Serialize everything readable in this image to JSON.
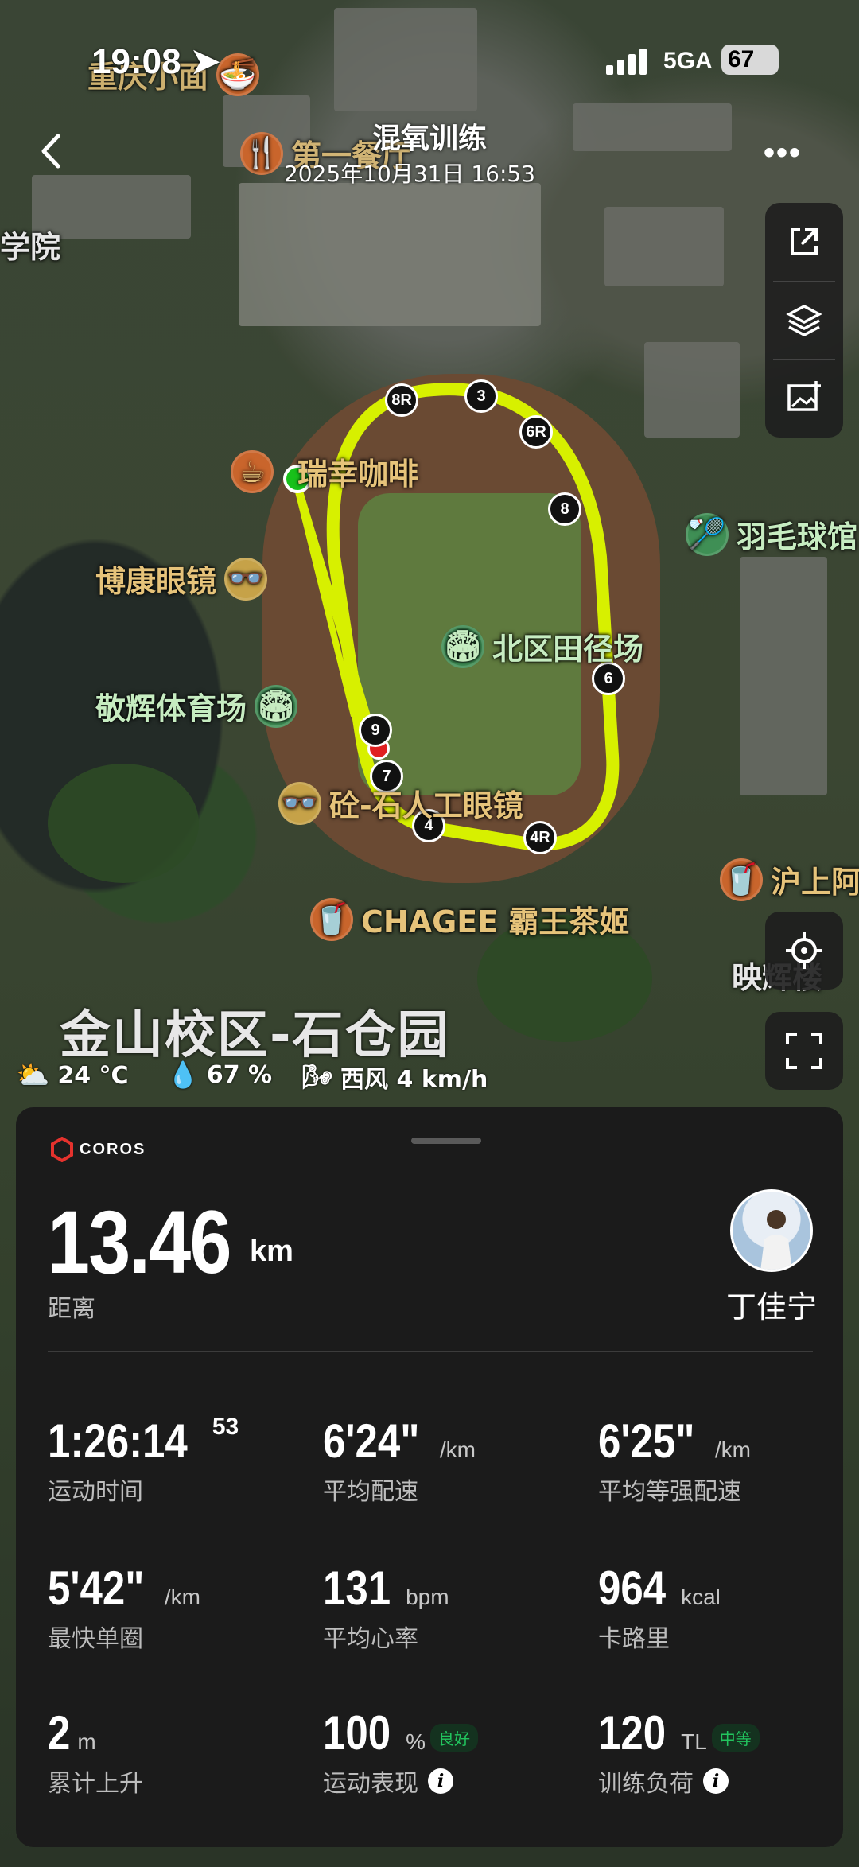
{
  "status_bar": {
    "time": "19:08",
    "network": "5GA",
    "battery": "67"
  },
  "header": {
    "title": "混氧训练",
    "datetime": "2025年10月31日 16:53"
  },
  "map_labels": {
    "poi_chongqing": "重庆小面",
    "poi_canteen": "第一餐厅",
    "poi_college": "学院",
    "poi_coffee": "瑞幸咖啡",
    "poi_glasses1": "博康眼镜",
    "poi_stadium": "敬辉体育场",
    "poi_glasses2": "砼-石人工眼镜",
    "poi_chagee": "CHAGEE 霸王茶姬",
    "poi_track": "北区田径场",
    "poi_badminton": "羽毛球馆",
    "poi_hushang": "沪上阿",
    "poi_yinghui": "映辉楼",
    "campus": "金山校区-石仓园"
  },
  "weather": {
    "temp": "24 °C",
    "humidity": "67 %",
    "wind": "西风 4 km/h"
  },
  "laps": [
    "8R",
    "3",
    "6R",
    "8",
    "6",
    "9",
    "7",
    "4",
    "4R"
  ],
  "brand": "COROS",
  "summary": {
    "distance": "13.46",
    "distance_unit": "km",
    "distance_label": "距离",
    "user_name": "丁佳宁"
  },
  "metrics": {
    "time": {
      "value": "1:26:14",
      "sup": "53",
      "label": "运动时间"
    },
    "avg_pace": {
      "value": "6'24\"",
      "unit": "/km",
      "label": "平均配速"
    },
    "grade_pace": {
      "value": "6'25\"",
      "unit": "/km",
      "label": "平均等强配速"
    },
    "fastest_lap": {
      "value": "5'42\"",
      "unit": "/km",
      "label": "最快单圈"
    },
    "heart_rate": {
      "value": "131",
      "unit": "bpm",
      "label": "平均心率"
    },
    "calories": {
      "value": "964",
      "unit": "kcal",
      "label": "卡路里"
    },
    "ascent": {
      "value": "2",
      "unit": "m",
      "label": "累计上升"
    },
    "performance": {
      "value": "100",
      "unit": "%",
      "badge": "良好",
      "label": "运动表现"
    },
    "load": {
      "value": "120",
      "unit": "TL",
      "badge": "中等",
      "label": "训练负荷"
    }
  },
  "colors": {
    "track_line": "#d7f000",
    "badge_green": "#22c55e",
    "card_bg": "#1b1b1b"
  }
}
